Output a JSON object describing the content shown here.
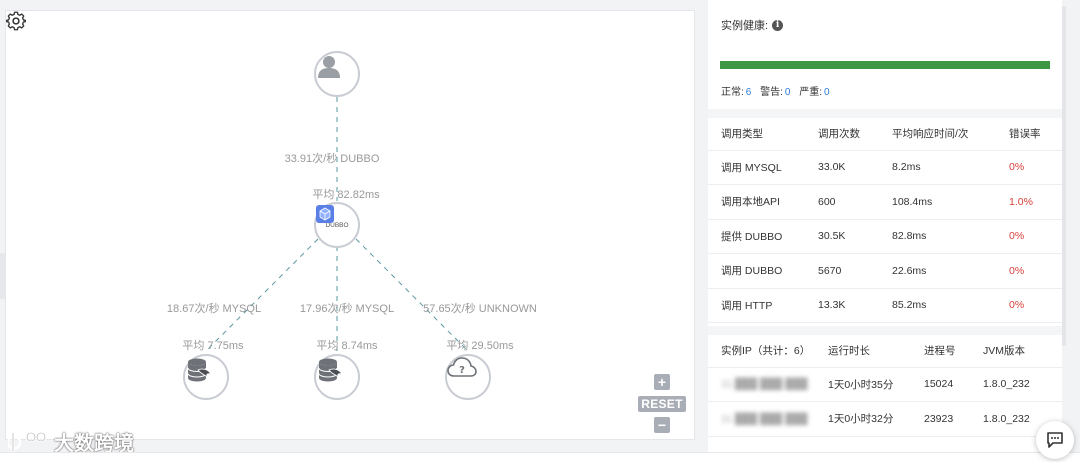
{
  "topology": {
    "nodes": [
      {
        "id": "user",
        "icon": "user-icon"
      },
      {
        "id": "service",
        "icon": "dubbo-cube-icon",
        "label": "DUBBO"
      },
      {
        "id": "db1",
        "icon": "database-icon"
      },
      {
        "id": "db2",
        "icon": "database-icon"
      },
      {
        "id": "unknown",
        "icon": "unknown-cloud-icon"
      }
    ],
    "edges": [
      {
        "from": "user",
        "to": "service",
        "rate": "33.91次/秒 DUBBO",
        "avg": "平均 82.82ms"
      },
      {
        "from": "service",
        "to": "db1",
        "rate": "18.67次/秒 MYSQL",
        "avg": "平均 7.75ms"
      },
      {
        "from": "service",
        "to": "db2",
        "rate": "17.96次/秒 MYSQL",
        "avg": "平均 8.74ms"
      },
      {
        "from": "service",
        "to": "unknown",
        "rate": "57.65次/秒 UNKNOWN",
        "avg": "平均 29.50ms"
      }
    ],
    "controls": {
      "zoom_in": "+",
      "reset": "RESET",
      "zoom_out": "−"
    }
  },
  "watermark": {
    "text": "大数跨境"
  },
  "health": {
    "title": "实例健康:",
    "bar_ratio": 1.0,
    "bar_color": "#3e9743",
    "stats": [
      {
        "label": "正常:",
        "value": "6"
      },
      {
        "label": "警告:",
        "value": "0"
      },
      {
        "label": "严重:",
        "value": "0"
      }
    ]
  },
  "calls": {
    "headers": [
      "调用类型",
      "调用次数",
      "平均响应时间/次",
      "错误率"
    ],
    "rows": [
      {
        "type": "调用 MYSQL",
        "count": "33.0K",
        "avg": "8.2ms",
        "error": "0%"
      },
      {
        "type": "调用本地API",
        "count": "600",
        "avg": "108.4ms",
        "error": "1.0%"
      },
      {
        "type": "提供 DUBBO",
        "count": "30.5K",
        "avg": "82.8ms",
        "error": "0%"
      },
      {
        "type": "调用 DUBBO",
        "count": "5670",
        "avg": "22.6ms",
        "error": "0%"
      },
      {
        "type": "调用 HTTP",
        "count": "13.3K",
        "avg": "85.2ms",
        "error": "0%"
      }
    ]
  },
  "instances": {
    "headers": [
      "实例IP（共计：6）",
      "运行时长",
      "进程号",
      "JVM版本"
    ],
    "rows": [
      {
        "ip": "11.███ ███ ███",
        "uptime": "1天0小时35分",
        "pid": "15024",
        "jvm": "1.8.0_232"
      },
      {
        "ip": "11.███ ███ ███",
        "uptime": "1天0小时32分",
        "pid": "23923",
        "jvm": "1.8.0_232"
      }
    ]
  },
  "colors": {
    "error": "#d9413a",
    "link": "#2f7cd6",
    "edge": "#5b9aa0"
  }
}
